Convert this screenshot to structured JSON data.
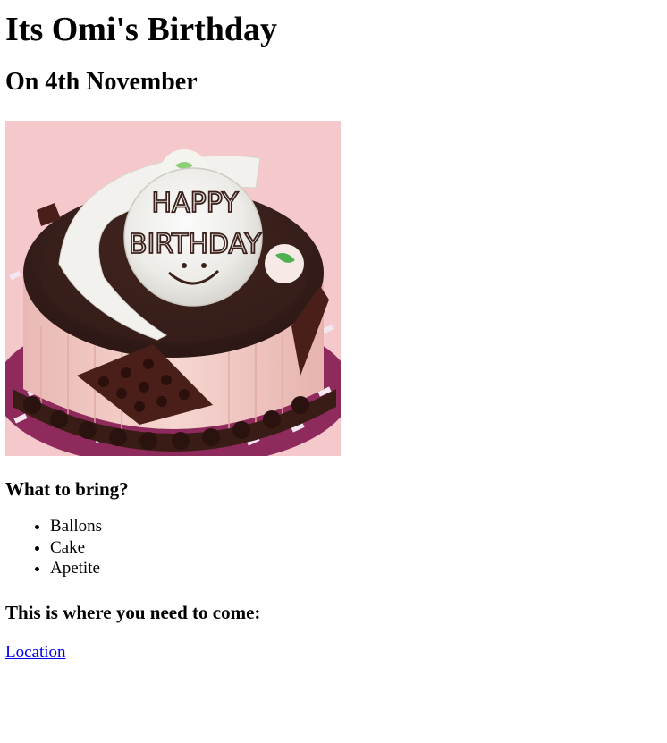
{
  "title": "Its Omi's Birthday",
  "subtitle": "On 4th November",
  "image": {
    "icon": "birthday-cake-image",
    "plaque_text_line1": "HAPPY",
    "plaque_text_line2": "BIRTHDAY"
  },
  "bring": {
    "heading": "What to bring?",
    "items": [
      "Ballons",
      "Cake",
      "Apetite"
    ]
  },
  "where": {
    "heading": "This is where you need to come:",
    "link_label": "Location"
  }
}
